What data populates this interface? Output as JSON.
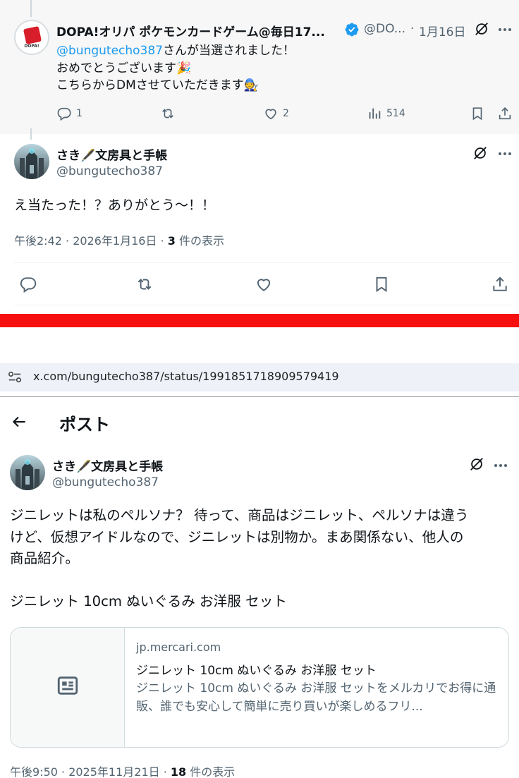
{
  "reply_tweet": {
    "author_name": "DOPA!オリパ ポケモンカードゲーム@毎日17...",
    "author_handle": "@DO...",
    "separator": "·",
    "date": "1月16日",
    "avatar_logo_text": "DOPA!",
    "lines": {
      "mention": "@bungutecho387",
      "line1_rest": "さんが当選されました！",
      "line2": "おめでとうございます🎉",
      "line3": "こちらからDMさせていただきます🧑‍🔧"
    },
    "actions": {
      "reply_count": "1",
      "retweet_count": "",
      "like_count": "2",
      "views_count": "514"
    }
  },
  "response_tweet": {
    "author_name": "さき🖋️文房具と手帳",
    "author_handle": "@bungutecho387",
    "text": "え当たった！？ありがとう～！！",
    "timestamp": "午後2:42 · 2026年1月16日 · ",
    "view_count": "3",
    "view_suffix": " 件の表示"
  },
  "divider_bar": {
    "color": "#f50f0f"
  },
  "address_bar": {
    "url": "x.com/bungutecho387/status/1991851718909579419"
  },
  "post_page": {
    "title": "ポスト"
  },
  "main_tweet": {
    "author_name": "さき🖋️文房具と手帳",
    "author_handle": "@bungutecho387",
    "paragraphs": [
      "ジニレットは私のペルソナ？ 待って、商品はジニレット、ペルソナは違う",
      "けど、仮想アイドルなので、ジニレットは別物か。まあ関係ない、他人の",
      "商品紹介。",
      "ジニレット 10cm ぬいぐるみ お洋服 セット"
    ],
    "link_card": {
      "domain": "jp.mercari.com",
      "title": "ジニレット 10cm ぬいぐるみ お洋服 セット",
      "description": "ジニレット 10cm ぬいぐるみ お洋服 セットをメルカリでお得に通販、誰でも安心して簡単に売り買いが楽しめるフリ..."
    },
    "timestamp": "午後9:50 · 2025年11月21日 · ",
    "view_count": "18",
    "view_suffix": " 件の表示"
  },
  "colors": {
    "accent": "#1d9bf0",
    "muted_text": "#536471",
    "reply_bg": "#f7f7f7"
  }
}
